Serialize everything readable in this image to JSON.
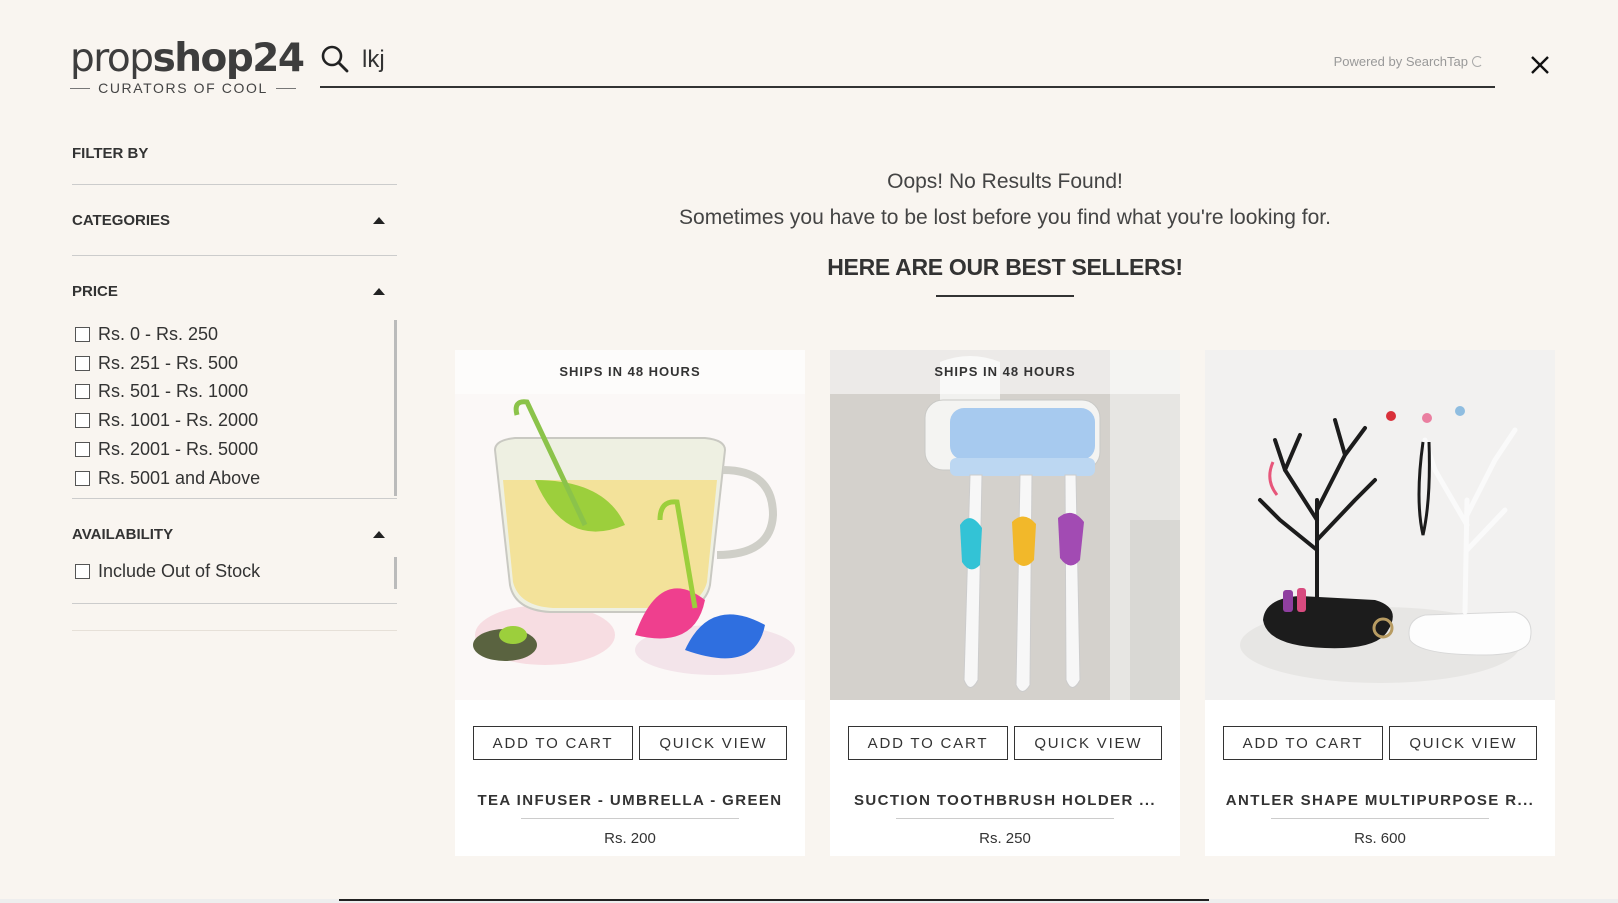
{
  "logo": {
    "part1": "prop",
    "part2": "shop24",
    "tagline": "CURATORS OF COOL"
  },
  "search": {
    "value": "lkj",
    "powered_by": "Powered by SearchTap"
  },
  "sidebar": {
    "title": "FILTER BY",
    "sections": [
      {
        "label": "CATEGORIES"
      },
      {
        "label": "PRICE",
        "options": [
          "Rs. 0 - Rs. 250",
          "Rs. 251 - Rs. 500",
          "Rs. 501 - Rs. 1000",
          "Rs. 1001 - Rs. 2000",
          "Rs. 2001 - Rs. 5000",
          "Rs. 5001 and Above"
        ]
      },
      {
        "label": "AVAILABILITY",
        "options": [
          "Include Out of Stock"
        ]
      }
    ]
  },
  "main": {
    "no_results": "Oops! No Results Found!",
    "sub_message": "Sometimes you have to be lost before you find what you're looking for.",
    "best_sellers_heading": "HERE ARE OUR BEST SELLERS!"
  },
  "products": [
    {
      "badge": "SHIPS IN 48 HOURS",
      "name": "TEA INFUSER - UMBRELLA - GREEN",
      "price": "Rs. 200",
      "add_to_cart": "ADD TO CART",
      "quick_view": "QUICK VIEW"
    },
    {
      "badge": "SHIPS IN 48 HOURS",
      "name": "SUCTION TOOTHBRUSH HOLDER ...",
      "price": "Rs. 250",
      "add_to_cart": "ADD TO CART",
      "quick_view": "QUICK VIEW"
    },
    {
      "badge": "",
      "name": "ANTLER SHAPE MULTIPURPOSE R...",
      "price": "Rs. 600",
      "add_to_cart": "ADD TO CART",
      "quick_view": "QUICK VIEW"
    }
  ],
  "colors": {
    "background": "#f9f5f0",
    "text": "#333333",
    "card": "#ffffff"
  }
}
